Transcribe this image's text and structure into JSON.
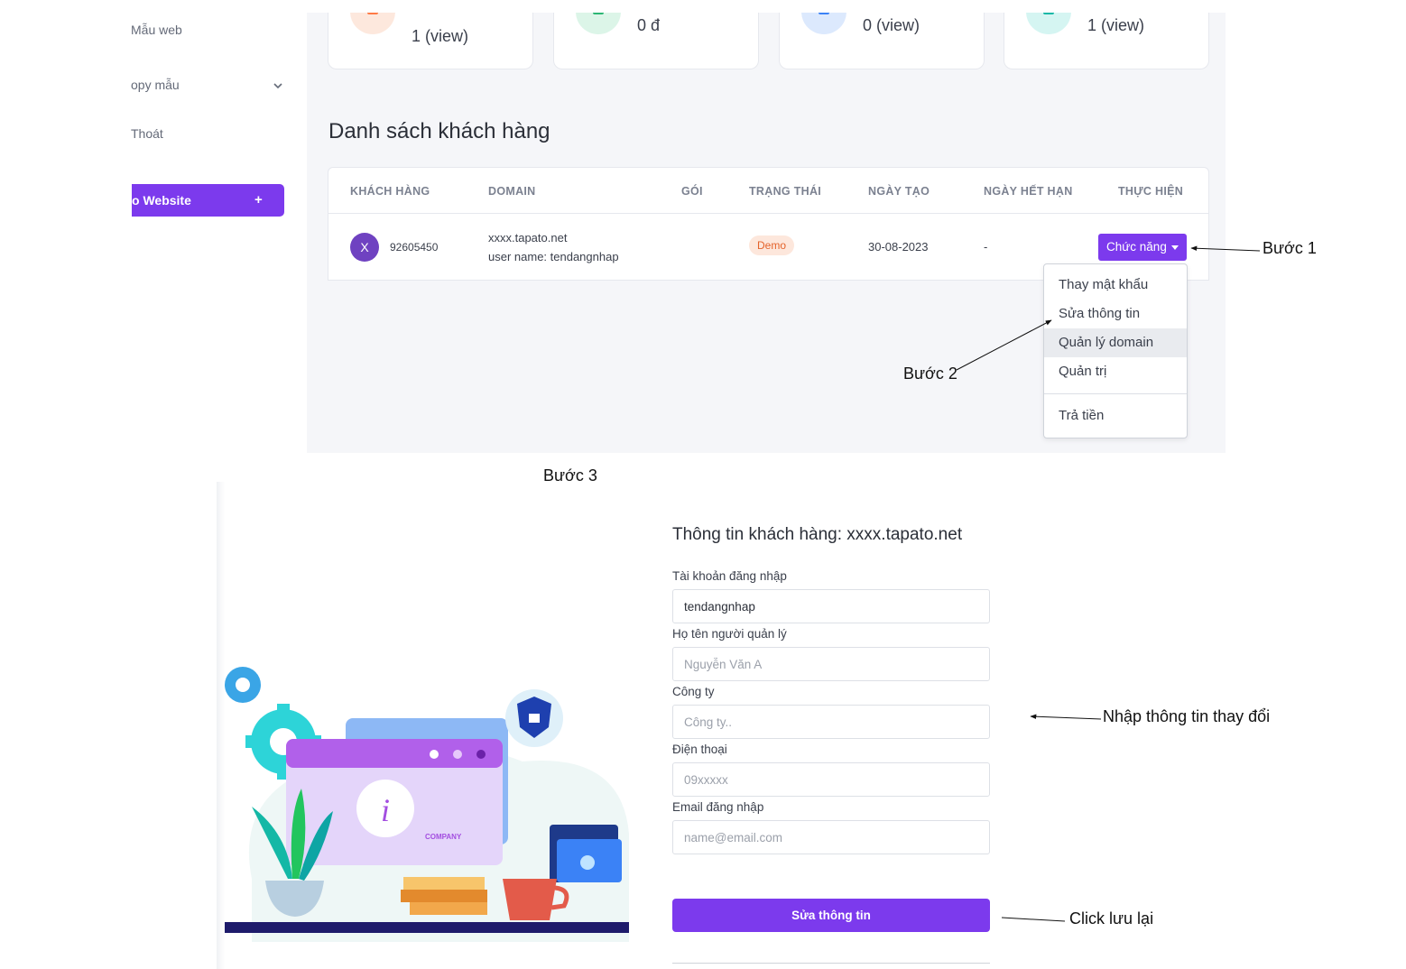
{
  "sidebar": {
    "items": [
      {
        "label": "Mẫu web"
      },
      {
        "label": "opy mẫu"
      },
      {
        "label": "Thoát"
      }
    ],
    "create_button": {
      "label": "o Website",
      "plus": "+"
    }
  },
  "stats": [
    {
      "value": "1 (view)",
      "icon": "cart-icon",
      "color": "#ff7a45"
    },
    {
      "value": "0 đ",
      "icon": "wallet-icon",
      "color": "#2bb673"
    },
    {
      "value": "0 (view)",
      "icon": "bag-icon",
      "color": "#3b82f6"
    },
    {
      "value": "1 (view)",
      "icon": "bag-icon",
      "color": "#14b8a6"
    }
  ],
  "customers": {
    "title": "Danh sách khách hàng",
    "columns": [
      "KHÁCH HÀNG",
      "DOMAIN",
      "GÓI",
      "TRẠNG THÁI",
      "NGÀY TẠO",
      "NGÀY HẾT HẠN",
      "THỰC HIỆN"
    ],
    "row": {
      "avatar": "X",
      "id": "92605450",
      "domain": "xxxx.tapato.net",
      "username": "user name: tendangnhap",
      "package": "",
      "status": "Demo",
      "created": "30-08-2023",
      "expires": "-",
      "action": "Chức năng"
    }
  },
  "dropdown": {
    "items": [
      "Thay mật khẩu",
      "Sửa thông tin",
      "Quản lý domain",
      "Quản trị",
      "Trả tiền"
    ],
    "highlighted": "Quản lý domain"
  },
  "annotations": {
    "step1": "Bước 1",
    "step2": "Bước 2",
    "step3": "Bước 3",
    "enter_info": "Nhập thông tin thay đổi",
    "click_save": "Click lưu lại"
  },
  "form": {
    "title": "Thông tin khách hàng: xxxx.tapato.net",
    "fields": [
      {
        "label": "Tài khoản đăng nhập",
        "value": "tendangnhap",
        "placeholder": ""
      },
      {
        "label": "Họ tên người quản lý",
        "value": "",
        "placeholder": "Nguyễn Văn A"
      },
      {
        "label": "Công ty",
        "value": "",
        "placeholder": "Công ty.."
      },
      {
        "label": "Điện thoại",
        "value": "",
        "placeholder": "09xxxxx"
      },
      {
        "label": "Email đăng nhập",
        "value": "",
        "placeholder": "name@email.com"
      }
    ],
    "submit": "Sửa thông tin"
  },
  "illustration": {
    "badge_text": "COMPANY",
    "info_letter": "i"
  }
}
